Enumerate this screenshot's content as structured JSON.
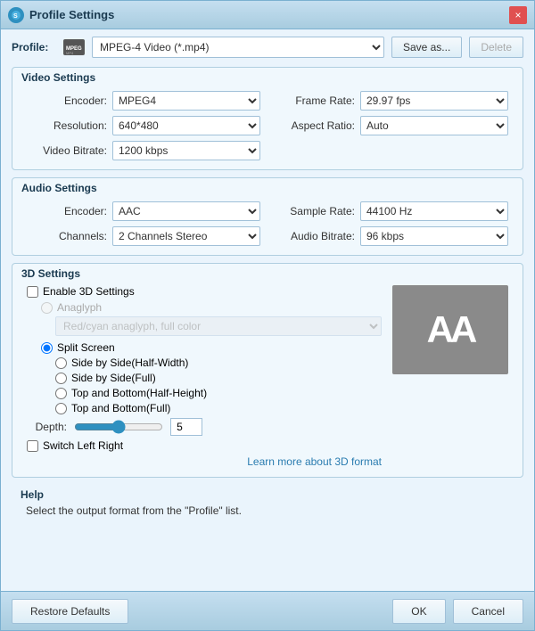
{
  "window": {
    "title": "Profile Settings",
    "close_label": "×"
  },
  "profile": {
    "label": "Profile:",
    "icon_text": "MP4",
    "selected": "MPEG-4 Video (*.mp4)",
    "save_as_label": "Save as...",
    "delete_label": "Delete"
  },
  "video_settings": {
    "title": "Video Settings",
    "encoder_label": "Encoder:",
    "encoder_value": "MPEG4",
    "resolution_label": "Resolution:",
    "resolution_value": "640*480",
    "video_bitrate_label": "Video Bitrate:",
    "video_bitrate_value": "1200 kbps",
    "frame_rate_label": "Frame Rate:",
    "frame_rate_value": "29.97 fps",
    "aspect_ratio_label": "Aspect Ratio:",
    "aspect_ratio_value": "Auto"
  },
  "audio_settings": {
    "title": "Audio Settings",
    "encoder_label": "Encoder:",
    "encoder_value": "AAC",
    "channels_label": "Channels:",
    "channels_value": "2 Channels Stereo",
    "sample_rate_label": "Sample Rate:",
    "sample_rate_value": "44100 Hz",
    "audio_bitrate_label": "Audio Bitrate:",
    "audio_bitrate_value": "96 kbps"
  },
  "settings_3d": {
    "title": "3D Settings",
    "enable_label": "Enable 3D Settings",
    "anaglyph_label": "Anaglyph",
    "anaglyph_dropdown": "Red/cyan anaglyph, full color",
    "split_screen_label": "Split Screen",
    "side_by_side_half_label": "Side by Side(Half-Width)",
    "side_by_side_full_label": "Side by Side(Full)",
    "top_bottom_half_label": "Top and Bottom(Half-Height)",
    "top_bottom_full_label": "Top and Bottom(Full)",
    "depth_label": "Depth:",
    "depth_value": "5",
    "switch_label": "Switch Left Right",
    "learn_more_label": "Learn more about 3D format",
    "aa_text": "AA"
  },
  "help": {
    "title": "Help",
    "text": "Select the output format from the \"Profile\" list."
  },
  "footer": {
    "restore_label": "Restore Defaults",
    "ok_label": "OK",
    "cancel_label": "Cancel"
  }
}
